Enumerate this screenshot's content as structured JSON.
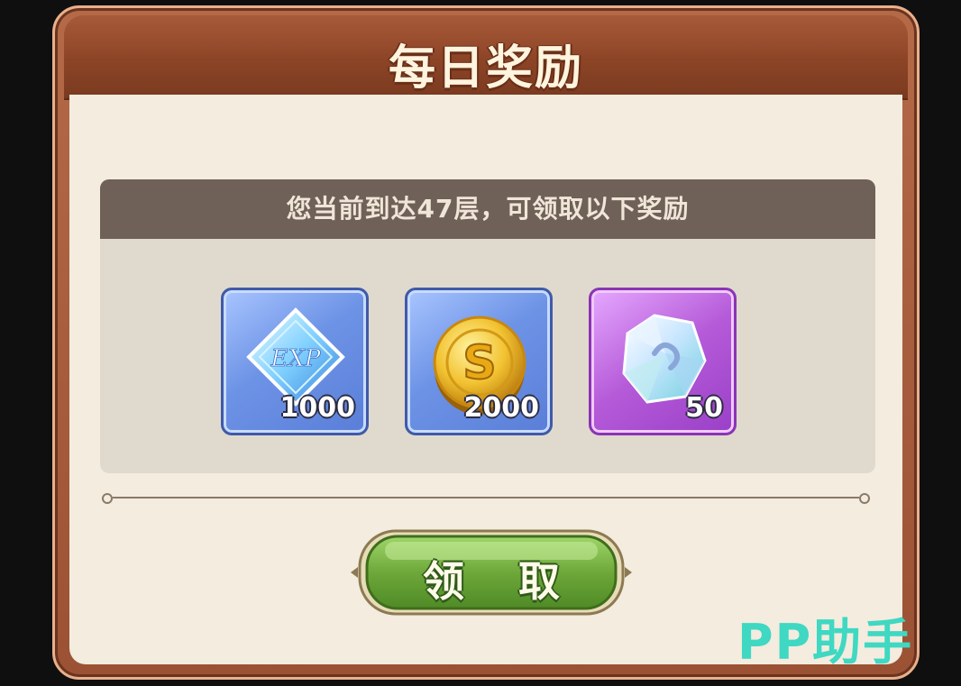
{
  "dialog": {
    "title": "每日奖励",
    "banner": "您当前到达47层，可领取以下奖励",
    "rewards": [
      {
        "icon": "exp-crystal-icon",
        "quantity": "1000",
        "rarity": "blue"
      },
      {
        "icon": "gold-coin-icon",
        "quantity": "2000",
        "rarity": "blue"
      },
      {
        "icon": "diamond-gem-icon",
        "quantity": "50",
        "rarity": "purple"
      }
    ],
    "claim_label": "领 取"
  },
  "watermark": "PP助手",
  "colors": {
    "frame": "#a85a39",
    "panel": "#f3ecdf",
    "banner": "#6f6058",
    "button": "#6ea83a",
    "watermark": "#3fd8c2"
  }
}
